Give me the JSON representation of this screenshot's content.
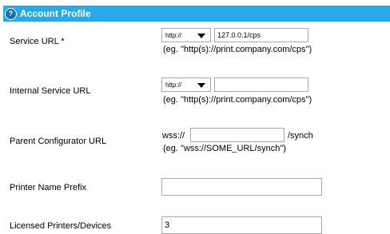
{
  "header": {
    "title": "Account Profile",
    "icon": "help-icon"
  },
  "fields": {
    "service_url": {
      "label": "Service URL *",
      "protocol": "http://",
      "value": "127.0.0.1/cps",
      "hint": "(eg. \"http(s)://print.company.com/cps\")"
    },
    "internal_service_url": {
      "label": "Internal Service URL",
      "protocol": "http://",
      "value": "",
      "hint": "(eg. \"http(s)://print.company.com/cps\")"
    },
    "parent_configurator_url": {
      "label": "Parent Configurator URL",
      "prefix": "wss://",
      "value": "",
      "suffix": "/synch",
      "hint": "(eg. \"wss://SOME_URL/synch\")"
    },
    "printer_name_prefix": {
      "label": "Printer Name Prefix",
      "value": ""
    },
    "licensed_printers": {
      "label": "Licensed Printers/Devices",
      "value": "3"
    }
  },
  "colors": {
    "header_bg": "#29a9e8",
    "header_text": "#ffffff"
  }
}
